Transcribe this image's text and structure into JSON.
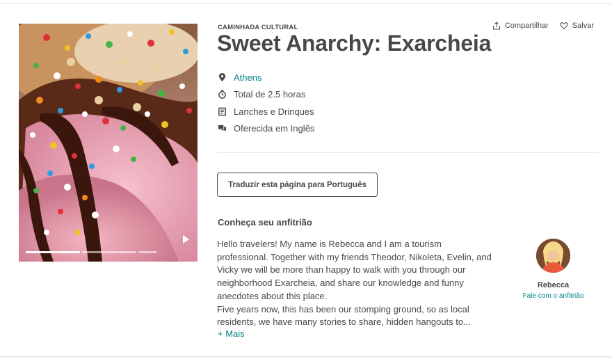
{
  "experience": {
    "category": "CAMINHADA CULTURAL",
    "title": "Sweet Anarchy: Exarcheia"
  },
  "actions": {
    "share_label": "Compartilhar",
    "save_label": "Salvar"
  },
  "facts": [
    {
      "icon": "location-pin-icon",
      "text": "Athens"
    },
    {
      "icon": "clock-icon",
      "text": "Total de 2.5 horas"
    },
    {
      "icon": "receipt-icon",
      "text": "Lanches e Drinques"
    },
    {
      "icon": "chat-bubbles-icon",
      "text": "Oferecida em Inglês"
    }
  ],
  "translate_button": "Traduzir esta página para Português",
  "host_section": {
    "heading": "Conheça seu anfitrião",
    "bio_lines": [
      "Hello travelers! My name is Rebecca and I am a tourism professional. Together with my friends Theodor, Nikoleta, Evelin, and Vicky we will be more than happy to walk with you through our neighborhood Exarcheia, and share our knowledge and funny anecdotes about this place.",
      "Five years now, this has been our stomping ground, so as local residents, we have many stories to share, hidden hangouts to..."
    ],
    "more_link": "+ Mais",
    "host_name": "Rebecca",
    "contact_link": "Fale com o anfitrião"
  },
  "media": {
    "slide_count": 3,
    "active_slide": 1
  },
  "colors": {
    "text": "#484848",
    "link": "#008489",
    "divider": "#e4e4e4"
  }
}
